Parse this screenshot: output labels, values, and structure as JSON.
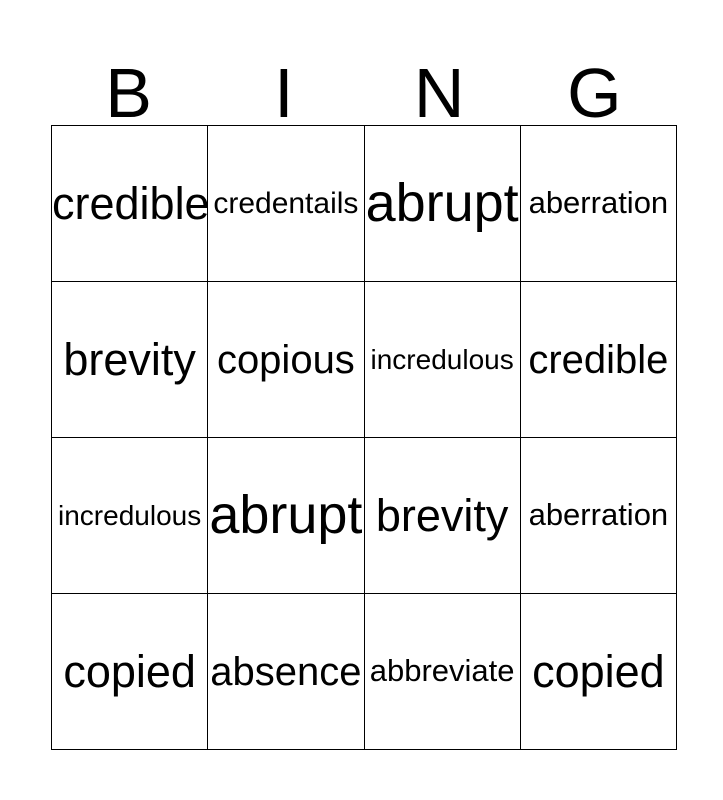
{
  "card": {
    "title_letters": [
      "B",
      "I",
      "N",
      "G"
    ],
    "columns": 4,
    "rows": 4,
    "background_color": "#ffffff",
    "text_color": "#000000",
    "border_color": "#000000",
    "grid": [
      [
        {
          "word": "credible",
          "size_class": "fs-lg"
        },
        {
          "word": "credentails",
          "size_class": "fs-xs"
        },
        {
          "word": "abrupt",
          "size_class": "fs-xl"
        },
        {
          "word": "aberration",
          "size_class": "fs-sm"
        }
      ],
      [
        {
          "word": "brevity",
          "size_class": "fs-lg"
        },
        {
          "word": "copious",
          "size_class": "fs-md"
        },
        {
          "word": "incredulous",
          "size_class": "fs-xxs"
        },
        {
          "word": "credible",
          "size_class": "fs-md"
        }
      ],
      [
        {
          "word": "incredulous",
          "size_class": "fs-xxs"
        },
        {
          "word": "abrupt",
          "size_class": "fs-xl"
        },
        {
          "word": "brevity",
          "size_class": "fs-lg"
        },
        {
          "word": "aberration",
          "size_class": "fs-sm"
        }
      ],
      [
        {
          "word": "copied",
          "size_class": "fs-lg"
        },
        {
          "word": "absence",
          "size_class": "fs-md"
        },
        {
          "word": "abbreviate",
          "size_class": "fs-sm"
        },
        {
          "word": "copied",
          "size_class": "fs-lg"
        }
      ]
    ]
  }
}
